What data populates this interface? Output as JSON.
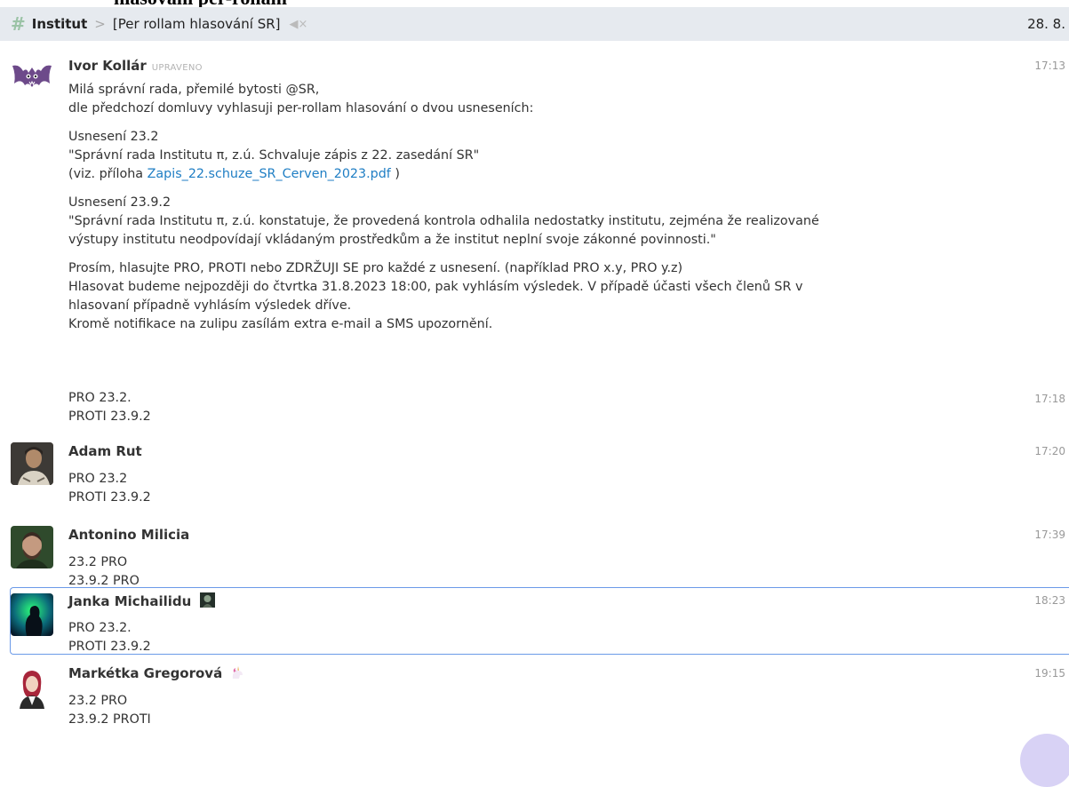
{
  "top_cutoff_title": "hlasování per-rollam",
  "header": {
    "stream": "Institut",
    "separator": ">",
    "topic": "[Per rollam hlasování SR]",
    "date": "28. 8."
  },
  "messages": [
    {
      "sender": "Ivor Kollár",
      "edited_label": "UPRAVENO",
      "time": "17:13",
      "lines": [
        "Milá správní rada, přemilé bytosti @SR,",
        "dle předchozí domluvy vyhlasuji per-rollam hlasování o dvou usneseních:",
        "Usnesení 23.2",
        "\"Správní rada Institutu π, z.ú. Schvaluje zápis z 22. zasedání SR\"",
        "(viz. příloha ",
        "Zapis_22.schuze_SR_Cerven_2023.pdf",
        " )",
        "Usnesení 23.9.2",
        "\"Správní rada Institutu π, z.ú. konstatuje, že provedená kontrola odhalila nedostatky institutu, zejména že realizované",
        "výstupy institutu neodpovídají vkládaným prostředkům a že institut neplní svoje zákonné povinnosti.\"",
        "Prosím, hlasujte PRO, PROTI nebo ZDRŽUJI SE pro každé z usnesení. (například PRO x.y, PRO y.z)",
        "Hlasovat budeme nejpozději do čtvrtka 31.8.2023 18:00, pak vyhlásím výsledek. V případě účasti všech členů SR v",
        "hlasovaní případně vyhlásím výsledek dříve.",
        "Kromě notifikace na zulipu zasílám extra e-mail a SMS upozornění."
      ]
    },
    {
      "time": "17:18",
      "lines": [
        "PRO 23.2.",
        "PROTI 23.9.2"
      ]
    },
    {
      "sender": "Adam Rut",
      "time": "17:20",
      "lines": [
        "PRO 23.2",
        "PROTI 23.9.2"
      ]
    },
    {
      "sender": "Antonino Milicia",
      "time": "17:39",
      "lines": [
        "23.2 PRO",
        "23.9.2 PRO"
      ]
    },
    {
      "sender": "Janka Michailidu",
      "time": "18:23",
      "lines": [
        "PRO 23.2.",
        "PROTI 23.9.2"
      ]
    },
    {
      "sender": "Markétka Gregorová",
      "time": "19:15",
      "lines": [
        "23.2 PRO",
        "23.9.2 PROTI"
      ]
    }
  ],
  "colors": {
    "header_bg": "#e6eaef",
    "hash": "#9bc3a6",
    "link": "#1f7ec4",
    "selection_border": "#6b9ae8"
  },
  "icons": [
    "hash-icon",
    "chevron-right-icon",
    "mute-icon",
    "bat-avatar",
    "unicorn-icon"
  ]
}
